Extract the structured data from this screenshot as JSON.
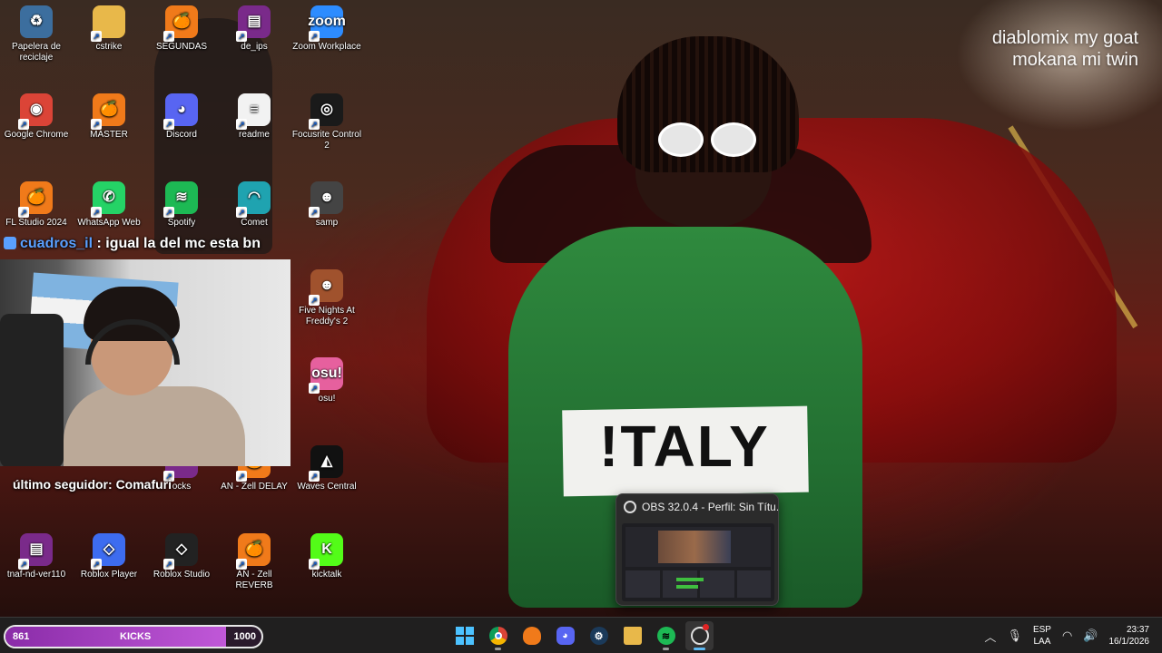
{
  "desktop": {
    "icons": [
      {
        "label": "Papelera de reciclaje",
        "glyph": "♻",
        "color": "#3c6e9e",
        "icon": "recycle-bin-icon"
      },
      {
        "label": "cstrike",
        "glyph": "",
        "color": "#e8b84a",
        "icon": "folder-icon"
      },
      {
        "label": "SEGUNDAS",
        "glyph": "🍊",
        "color": "#f07a1a",
        "icon": "fl-studio-icon"
      },
      {
        "label": "de_ips",
        "glyph": "▤",
        "color": "#7a2a8a",
        "icon": "winrar-icon"
      },
      {
        "label": "Zoom Workplace",
        "glyph": "zoom",
        "color": "#2d8cff",
        "icon": "zoom-icon"
      },
      {
        "label": "Google Chrome",
        "glyph": "◉",
        "color": "#db4437",
        "icon": "chrome-icon"
      },
      {
        "label": "MASTER",
        "glyph": "🍊",
        "color": "#f07a1a",
        "icon": "fl-studio-icon"
      },
      {
        "label": "Discord",
        "glyph": "◕",
        "color": "#5865f2",
        "icon": "discord-icon"
      },
      {
        "label": "readme",
        "glyph": "≡",
        "color": "#f2f2f2",
        "icon": "text-file-icon"
      },
      {
        "label": "Focusrite Control 2",
        "glyph": "◎",
        "color": "#1a1a1a",
        "icon": "focusrite-icon"
      },
      {
        "label": "FL Studio 2024",
        "glyph": "🍊",
        "color": "#f07a1a",
        "icon": "fl-studio-icon"
      },
      {
        "label": "WhatsApp Web",
        "glyph": "✆",
        "color": "#25d366",
        "icon": "whatsapp-icon"
      },
      {
        "label": "Spotify",
        "glyph": "≋",
        "color": "#1db954",
        "icon": "spotify-icon"
      },
      {
        "label": "Comet",
        "glyph": "◠",
        "color": "#1fa3b0",
        "icon": "comet-icon"
      },
      {
        "label": "samp",
        "glyph": "☻",
        "color": "#444444",
        "icon": "samp-icon"
      },
      {
        "label": "Five Nights At Freddy's 2",
        "glyph": "☻",
        "color": "#a0522d",
        "icon": "fnaf-icon"
      },
      {
        "label": "osu!",
        "glyph": "osu!",
        "color": "#e6609e",
        "icon": "osu-icon"
      },
      {
        "label": "Waves Central",
        "glyph": "◭",
        "color": "#111111",
        "icon": "waves-icon"
      },
      {
        "label": "AN - Zell DELAY",
        "glyph": "🍊",
        "color": "#f07a1a",
        "icon": "fl-studio-icon"
      },
      {
        "label": "ocks",
        "glyph": "",
        "color": "#7a2a8a",
        "icon": "app-icon"
      },
      {
        "label": "tnaf-nd-ver110",
        "glyph": "▤",
        "color": "#7a2a8a",
        "icon": "winrar-icon"
      },
      {
        "label": "Roblox Player",
        "glyph": "◇",
        "color": "#3d6cf0",
        "icon": "roblox-icon"
      },
      {
        "label": "Roblox Studio",
        "glyph": "◇",
        "color": "#222222",
        "icon": "roblox-studio-icon"
      },
      {
        "label": "AN - Zell REVERB",
        "glyph": "🍊",
        "color": "#f07a1a",
        "icon": "fl-studio-icon"
      },
      {
        "label": "kicktalk",
        "glyph": "K",
        "color": "#53fc18",
        "icon": "kicktalk-icon"
      }
    ]
  },
  "overlay": {
    "chat_user": "cuadros_il",
    "chat_message": " : igual la del mc esta bn",
    "goat_line1": "diablomix my goat",
    "goat_line2": "mokana mi twin",
    "follower_label": "último seguidor: ",
    "follower_name": "Comafuri"
  },
  "obs_preview": {
    "title": "OBS 32.0.4 - Perfil: Sin Títu..."
  },
  "taskbar": {
    "kicks": {
      "current": "861",
      "label": "KICKS",
      "goal": "1000",
      "progress": 0.861
    },
    "apps": [
      {
        "icon": "windows-start-icon",
        "color": "#4cc2ff"
      },
      {
        "icon": "chrome-icon",
        "color": "#db4437"
      },
      {
        "icon": "fl-studio-icon",
        "color": "#f07a1a"
      },
      {
        "icon": "discord-icon",
        "color": "#5865f2"
      },
      {
        "icon": "steam-icon",
        "color": "#1b3a5a"
      },
      {
        "icon": "file-explorer-icon",
        "color": "#e8b84a"
      },
      {
        "icon": "spotify-icon",
        "color": "#1db954"
      },
      {
        "icon": "obs-icon",
        "color": "#2b2b2b"
      }
    ],
    "lang_top": "ESP",
    "lang_bottom": "LAA",
    "time": "23:37",
    "date": "16/1/2026"
  },
  "scene": {
    "shirt_text": "!TALY"
  }
}
